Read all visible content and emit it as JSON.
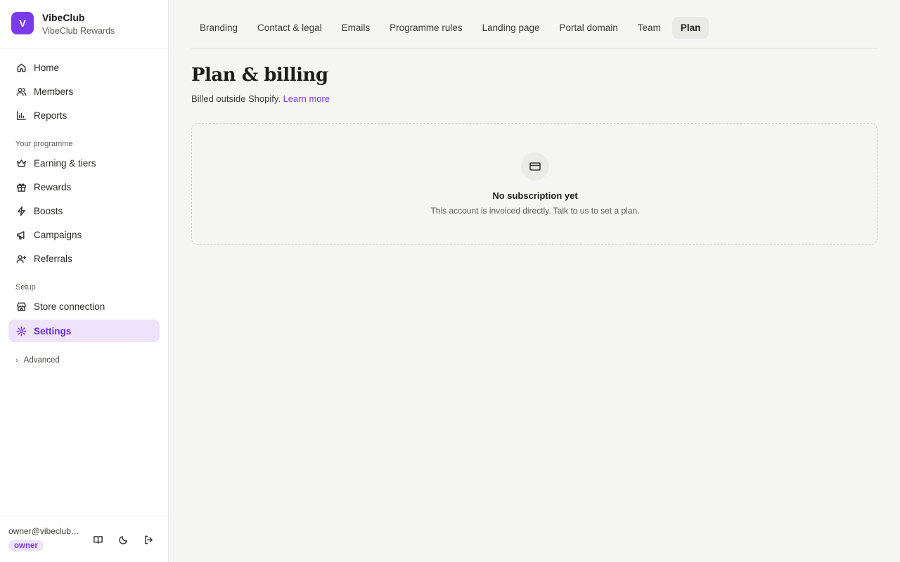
{
  "brand": {
    "initial": "V",
    "name": "VibeClub",
    "subtitle": "VibeClub Rewards"
  },
  "nav": {
    "main": [
      {
        "label": "Home",
        "icon": "home-icon"
      },
      {
        "label": "Members",
        "icon": "users-icon"
      },
      {
        "label": "Reports",
        "icon": "bar-chart-icon"
      }
    ],
    "programme_label": "Your programme",
    "programme": [
      {
        "label": "Earning & tiers",
        "icon": "crown-icon"
      },
      {
        "label": "Rewards",
        "icon": "gift-icon"
      },
      {
        "label": "Boosts",
        "icon": "lightning-icon"
      },
      {
        "label": "Campaigns",
        "icon": "megaphone-icon"
      },
      {
        "label": "Referrals",
        "icon": "user-plus-icon"
      }
    ],
    "setup_label": "Setup",
    "setup": [
      {
        "label": "Store connection",
        "icon": "store-icon"
      },
      {
        "label": "Settings",
        "icon": "gear-icon",
        "active": true
      }
    ],
    "advanced_label": "Advanced"
  },
  "footer": {
    "email": "owner@vibeclub…",
    "role": "owner"
  },
  "tabs": [
    {
      "label": "Branding"
    },
    {
      "label": "Contact & legal"
    },
    {
      "label": "Emails"
    },
    {
      "label": "Programme rules"
    },
    {
      "label": "Landing page"
    },
    {
      "label": "Portal domain"
    },
    {
      "label": "Team"
    },
    {
      "label": "Plan",
      "active": true
    }
  ],
  "page": {
    "title": "Plan & billing",
    "subtitle_text": "Billed outside Shopify.",
    "subtitle_link": "Learn more"
  },
  "empty_state": {
    "icon": "credit-card-icon",
    "title": "No subscription yet",
    "text": "This account is invoiced directly. Talk to us to set a plan."
  },
  "colors": {
    "accent": "#7c3aed",
    "active_bg": "#ede4fb",
    "background": "#f5f5f4"
  }
}
